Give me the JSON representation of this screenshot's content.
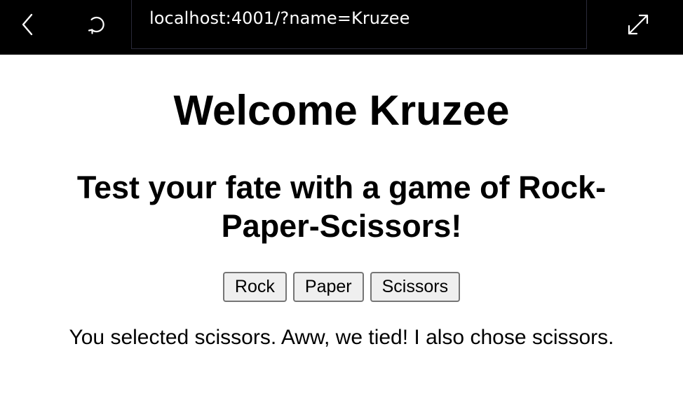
{
  "browser": {
    "url": "localhost:4001/?name=Kruzee",
    "icons": {
      "back": "chevron-left-icon",
      "reload": "reload-icon",
      "expand": "expand-icon"
    }
  },
  "page": {
    "heading": "Welcome Kruzee",
    "subtitle": "Test your fate with a game of Rock-Paper-Scissors!",
    "buttons": {
      "rock": "Rock",
      "paper": "Paper",
      "scissors": "Scissors"
    },
    "result": "You selected scissors. Aww, we tied! I also chose scissors."
  },
  "colors": {
    "toolbar_bg": "#000000",
    "page_bg": "#ffffff",
    "button_bg": "#efefef",
    "button_border": "#767676"
  }
}
